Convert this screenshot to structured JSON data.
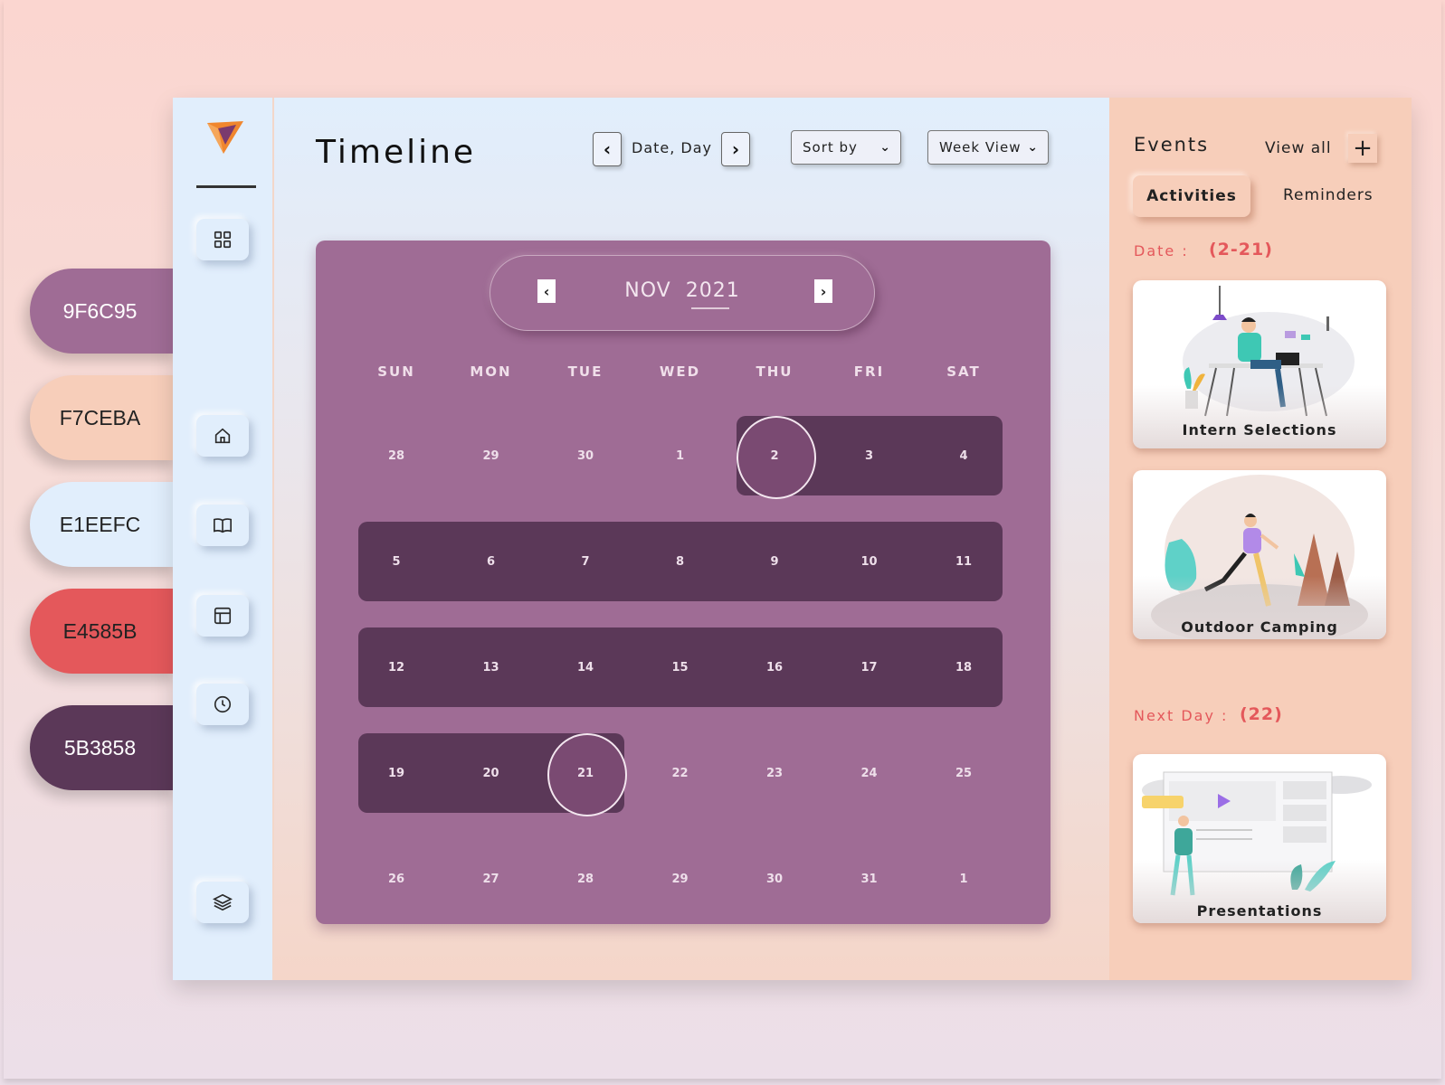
{
  "palette": [
    {
      "label": "9F6C95",
      "hex": "#9F6C95"
    },
    {
      "label": "F7CEBA",
      "hex": "#F7CEBA"
    },
    {
      "label": "E1EEFC",
      "hex": "#E1EEFC"
    },
    {
      "label": "E4585B",
      "hex": "#E4585B"
    },
    {
      "label": "5B3858",
      "hex": "#5B3858"
    }
  ],
  "sidebar": {
    "icons": [
      "grid-icon",
      "home-icon",
      "book-icon",
      "layout-icon",
      "clock-icon",
      "layers-icon"
    ]
  },
  "header": {
    "title": "Timeline",
    "date_label": "Date, Day",
    "sort_label": "Sort by",
    "view_label": "Week View"
  },
  "calendar": {
    "month": "NOV",
    "year": "2021",
    "weekdays": [
      "SUN",
      "MON",
      "TUE",
      "WED",
      "THU",
      "FRI",
      "SAT"
    ],
    "weeks": [
      [
        "28",
        "29",
        "30",
        "1",
        "2",
        "3",
        "4"
      ],
      [
        "5",
        "6",
        "7",
        "8",
        "9",
        "10",
        "11"
      ],
      [
        "12",
        "13",
        "14",
        "15",
        "16",
        "17",
        "18"
      ],
      [
        "19",
        "20",
        "21",
        "22",
        "23",
        "24",
        "25"
      ],
      [
        "26",
        "27",
        "28",
        "29",
        "30",
        "31",
        "1"
      ]
    ],
    "range_start": "2",
    "range_end": "21"
  },
  "events": {
    "title": "Events",
    "view_all": "View all",
    "add_symbol": "+",
    "tabs": {
      "active": "Activities",
      "inactive": "Reminders"
    },
    "date_label": "Date :",
    "date_value": "(2-21)",
    "next_day_label": "Next Day :",
    "next_day_value": "(22)",
    "cards": [
      {
        "title": "Intern Selections"
      },
      {
        "title": "Outdoor Camping"
      },
      {
        "title": "Presentations"
      }
    ]
  }
}
